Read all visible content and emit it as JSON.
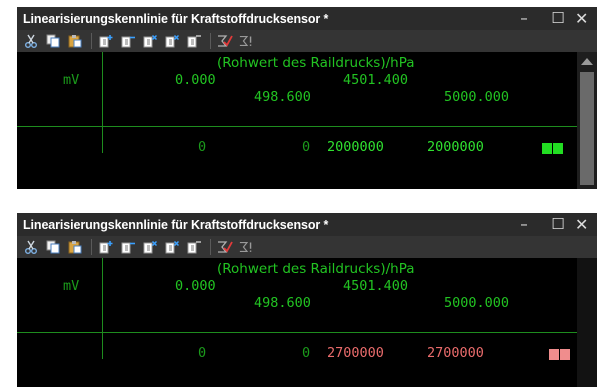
{
  "windows": [
    {
      "title": "Linearisierungskennlinie für Kraftstoffdrucksensor *",
      "controls": {
        "minimize": "–",
        "maximize": "☐",
        "close": "✕"
      },
      "grid": {
        "x_axis_label": "(Rohwert des Raildrucks)/hPa",
        "y_axis_label": "mV",
        "x_values_row1": [
          "0.000",
          "4501.400"
        ],
        "x_values_row2": [
          "498.600",
          "5000.000"
        ],
        "data_row": [
          "0",
          "0",
          "2000000",
          "2000000"
        ],
        "value_color": "#30e030",
        "marker_color": "#22dd22"
      }
    },
    {
      "title": "Linearisierungskennlinie für Kraftstoffdrucksensor *",
      "controls": {
        "minimize": "–",
        "maximize": "☐",
        "close": "✕"
      },
      "grid": {
        "x_axis_label": "(Rohwert des Raildrucks)/hPa",
        "y_axis_label": "mV",
        "x_values_row1": [
          "0.000",
          "4501.400"
        ],
        "x_values_row2": [
          "498.600",
          "5000.000"
        ],
        "data_row": [
          "0",
          "0",
          "2700000",
          "2700000"
        ],
        "value_color": "#ea6c6c",
        "marker_color": "#f08d8d"
      }
    }
  ],
  "toolbar_icons": [
    "cut-icon",
    "copy-icon",
    "paste-icon",
    "insert-column-icon",
    "delete-column-icon",
    "clear-column-icon",
    "insert-row-icon",
    "delete-row-icon",
    "check-sum-icon",
    "sigma-icon"
  ]
}
